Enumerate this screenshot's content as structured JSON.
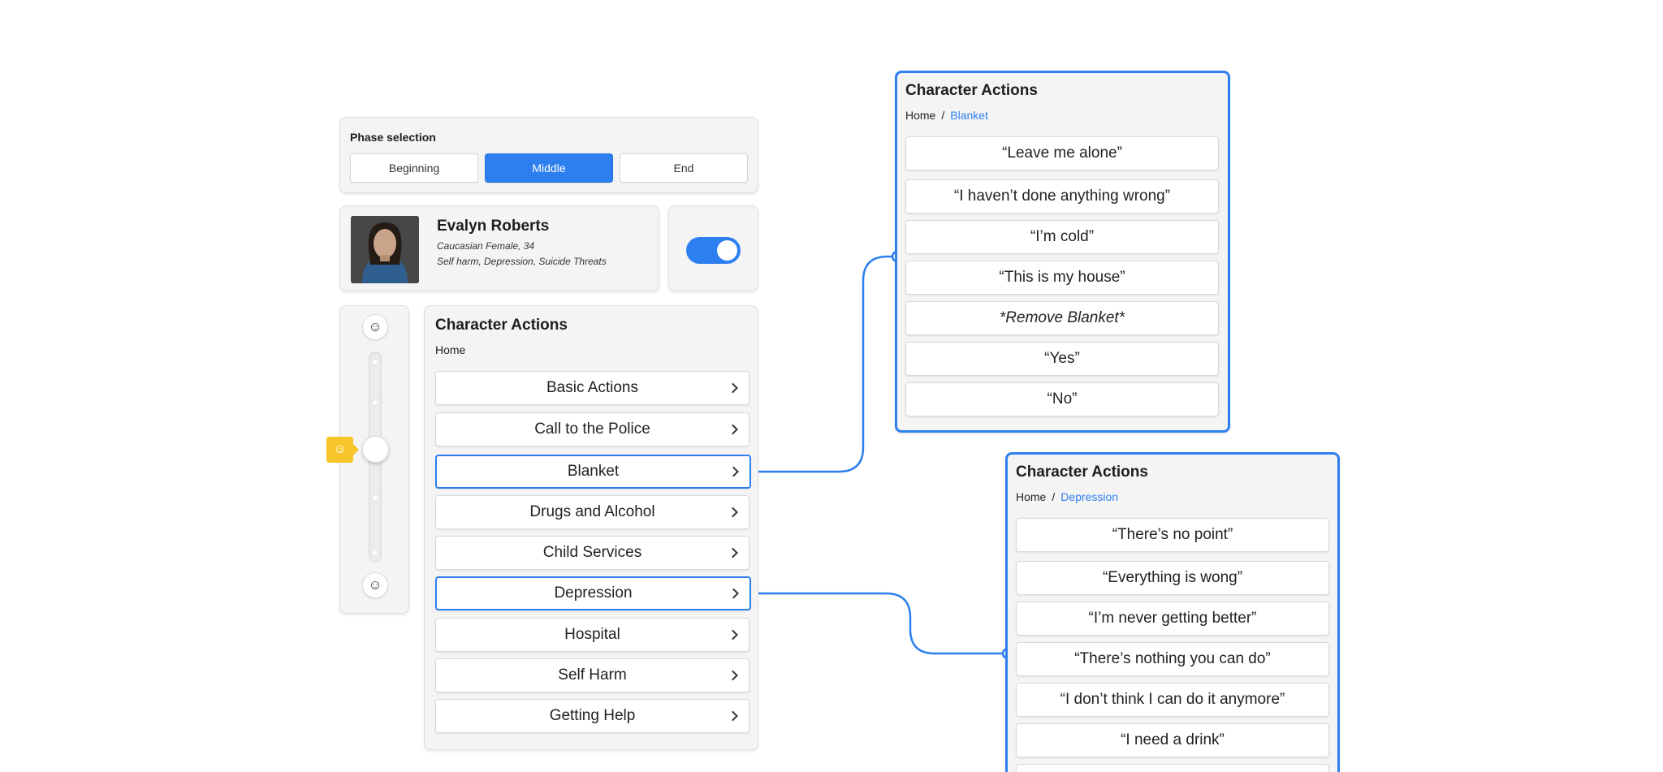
{
  "phase": {
    "title": "Phase selection",
    "options": [
      "Beginning",
      "Middle",
      "End"
    ],
    "selected": "Middle"
  },
  "profile": {
    "name": "Evalyn Roberts",
    "demographic": "Caucasian Female, 34",
    "conditions": "Self harm, Depression, Suicide Threats"
  },
  "toggle": {
    "on": true
  },
  "mood_slider": {
    "top_icon": "smile-icon",
    "bottom_icon": "smile-icon",
    "badge_icon": "smile-icon",
    "badge_color": "#f5c529"
  },
  "main_panel": {
    "title": "Character Actions",
    "breadcrumb": [
      "Home"
    ],
    "items": [
      {
        "label": "Basic Actions"
      },
      {
        "label": "Call to the Police"
      },
      {
        "label": "Blanket",
        "selected": true
      },
      {
        "label": "Drugs and Alcohol"
      },
      {
        "label": "Child Services"
      },
      {
        "label": "Depression",
        "selected": true
      },
      {
        "label": "Hospital"
      },
      {
        "label": "Self Harm"
      },
      {
        "label": "Getting Help"
      }
    ]
  },
  "blanket_panel": {
    "title": "Character Actions",
    "breadcrumb": [
      "Home",
      "Blanket"
    ],
    "items": [
      {
        "label": "“Leave me alone”"
      },
      {
        "label": "“I haven’t done anything wrong”"
      },
      {
        "label": "“I’m cold”"
      },
      {
        "label": "“This is my house”"
      },
      {
        "label": "*Remove Blanket*",
        "italic": true
      },
      {
        "label": "“Yes”"
      },
      {
        "label": "“No”"
      }
    ]
  },
  "depression_panel": {
    "title": "Character Actions",
    "breadcrumb": [
      "Home",
      "Depression"
    ],
    "items": [
      {
        "label": "“There’s no point”"
      },
      {
        "label": "“Everything is wong”"
      },
      {
        "label": "“I’m never getting better”"
      },
      {
        "label": "“There’s nothing you can do”"
      },
      {
        "label": "“I don’t think I can do it anymore”"
      },
      {
        "label": "“I need a drink”"
      }
    ]
  },
  "colors": {
    "accent": "#2d7ff0",
    "card_bg": "#f4f4f4",
    "badge": "#f5c529"
  }
}
